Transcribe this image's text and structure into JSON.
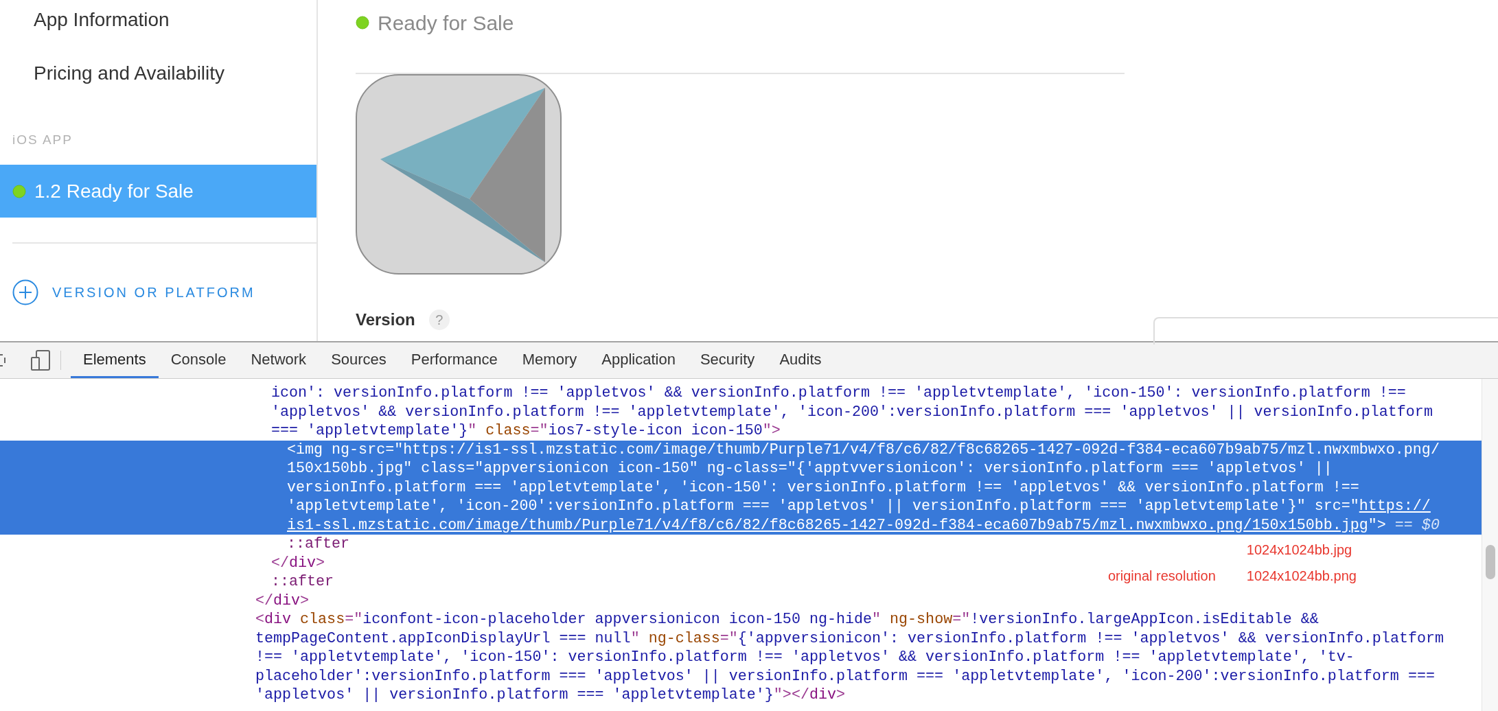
{
  "sidebar": {
    "items": [
      {
        "label": "App Information",
        "selected": false
      },
      {
        "label": "Pricing and Availability",
        "selected": false
      }
    ],
    "section_header": "iOS APP",
    "versions": [
      {
        "label": "1.2 Ready for Sale",
        "selected": true
      }
    ],
    "add_button": "VERSION OR PLATFORM"
  },
  "status": {
    "label": "Ready for Sale"
  },
  "version_field": {
    "label": "Version",
    "help": "?"
  },
  "devtools": {
    "tabs": [
      {
        "label": "Elements",
        "selected": true
      },
      {
        "label": "Console",
        "selected": false
      },
      {
        "label": "Network",
        "selected": false
      },
      {
        "label": "Sources",
        "selected": false
      },
      {
        "label": "Performance",
        "selected": false
      },
      {
        "label": "Memory",
        "selected": false
      },
      {
        "label": "Application",
        "selected": false
      },
      {
        "label": "Security",
        "selected": false
      },
      {
        "label": "Audits",
        "selected": false
      }
    ],
    "elements_tree": [
      {
        "children": [
          {
            "selected": false,
            "lines": [
              [
                {
                  "kind": "value",
                  "text": "icon': versionInfo.platform !== 'appletvos' && versionInfo.platform !== 'appletvtemplate', 'icon-150': versionInfo.platform !=="
                }
              ],
              [
                {
                  "kind": "value",
                  "text": "'appletvos' && versionInfo.platform !== 'appletvtemplate', 'icon-200':versionInfo.platform === 'appletvos' || versionInfo.platform"
                }
              ],
              [
                {
                  "kind": "value",
                  "text": "=== 'appletvtemplate'}"
                },
                {
                  "kind": "punct",
                  "text": "\""
                },
                {
                  "kind": "attr",
                  "text": " class"
                },
                {
                  "kind": "punct",
                  "text": "=\""
                },
                {
                  "kind": "value",
                  "text": "ios7-style-icon icon-150"
                },
                {
                  "kind": "punct",
                  "text": "\">"
                }
              ]
            ],
            "children": [
              {
                "selected": true,
                "lines": [
                  [
                    {
                      "kind": "punct",
                      "text": "<"
                    },
                    {
                      "kind": "tag",
                      "text": "img"
                    },
                    {
                      "kind": "attr",
                      "text": " ng-src"
                    },
                    {
                      "kind": "punct",
                      "text": "=\""
                    },
                    {
                      "kind": "value",
                      "text": "https://is1-ssl.mzstatic.com/image/thumb/Purple71/v4/f8/c6/82/f8c68265-1427-092d-f384-eca607b9ab75/mzl.nwxmbwxo.png/"
                    }
                  ],
                  [
                    {
                      "kind": "value",
                      "text": "150x150bb.jpg"
                    },
                    {
                      "kind": "punct",
                      "text": "\""
                    },
                    {
                      "kind": "attr",
                      "text": " class"
                    },
                    {
                      "kind": "punct",
                      "text": "=\""
                    },
                    {
                      "kind": "value",
                      "text": "appversionicon icon-150"
                    },
                    {
                      "kind": "punct",
                      "text": "\""
                    },
                    {
                      "kind": "attr",
                      "text": " ng-class"
                    },
                    {
                      "kind": "punct",
                      "text": "=\""
                    },
                    {
                      "kind": "value",
                      "text": "{'apptvversionicon': versionInfo.platform === 'appletvos' ||"
                    }
                  ],
                  [
                    {
                      "kind": "value",
                      "text": "versionInfo.platform === 'appletvtemplate', 'icon-150': versionInfo.platform !== 'appletvos' && versionInfo.platform !=="
                    }
                  ],
                  [
                    {
                      "kind": "value",
                      "text": "'appletvtemplate', 'icon-200':versionInfo.platform === 'appletvos' || versionInfo.platform === 'appletvtemplate'}"
                    },
                    {
                      "kind": "punct",
                      "text": "\""
                    },
                    {
                      "kind": "attr",
                      "text": " src"
                    },
                    {
                      "kind": "punct",
                      "text": "=\""
                    },
                    {
                      "kind": "link",
                      "text": "https://"
                    }
                  ],
                  [
                    {
                      "kind": "link",
                      "text": "is1-ssl.mzstatic.com/image/thumb/Purple71/v4/f8/c6/82/f8c68265-1427-092d-f384-eca607b9ab75/mzl.nwxmbwxo.png/150x150bb.jpg"
                    },
                    {
                      "kind": "punct",
                      "text": "\">"
                    },
                    {
                      "kind": "ref",
                      "text": " == $0"
                    }
                  ]
                ]
              },
              {
                "selected": false,
                "lines": [
                  [
                    {
                      "kind": "pseudo",
                      "text": "::after"
                    }
                  ]
                ]
              }
            ],
            "close": [
              {
                "kind": "punct",
                "text": "</"
              },
              {
                "kind": "tag",
                "text": "div"
              },
              {
                "kind": "punct",
                "text": ">"
              }
            ]
          },
          {
            "selected": false,
            "lines": [
              [
                {
                  "kind": "pseudo",
                  "text": "::after"
                }
              ]
            ]
          }
        ],
        "close": [
          {
            "kind": "punct",
            "text": "</"
          },
          {
            "kind": "tag",
            "text": "div"
          },
          {
            "kind": "punct",
            "text": ">"
          }
        ]
      },
      {
        "selected": false,
        "lines": [
          [
            {
              "kind": "punct",
              "text": "<"
            },
            {
              "kind": "tag",
              "text": "div"
            },
            {
              "kind": "attr",
              "text": " class"
            },
            {
              "kind": "punct",
              "text": "=\""
            },
            {
              "kind": "value",
              "text": "iconfont-icon-placeholder appversionicon icon-150 ng-hide"
            },
            {
              "kind": "punct",
              "text": "\""
            },
            {
              "kind": "attr",
              "text": " ng-show"
            },
            {
              "kind": "punct",
              "text": "=\""
            },
            {
              "kind": "value",
              "text": "!versionInfo.largeAppIcon.isEditable &&"
            }
          ],
          [
            {
              "kind": "value",
              "text": "tempPageContent.appIconDisplayUrl === null"
            },
            {
              "kind": "punct",
              "text": "\""
            },
            {
              "kind": "attr",
              "text": " ng-class"
            },
            {
              "kind": "punct",
              "text": "=\""
            },
            {
              "kind": "value",
              "text": "{'appversionicon': versionInfo.platform !== 'appletvos' && versionInfo.platform"
            }
          ],
          [
            {
              "kind": "value",
              "text": "!== 'appletvtemplate', 'icon-150': versionInfo.platform !== 'appletvos' && versionInfo.platform !== 'appletvtemplate', 'tv-"
            }
          ],
          [
            {
              "kind": "value",
              "text": "placeholder':versionInfo.platform === 'appletvos' || versionInfo.platform === 'appletvtemplate', 'icon-200':versionInfo.platform ==="
            }
          ],
          [
            {
              "kind": "value",
              "text": "'appletvos' || versionInfo.platform === 'appletvtemplate'}"
            },
            {
              "kind": "punct",
              "text": "\"></"
            },
            {
              "kind": "tag",
              "text": "div"
            },
            {
              "kind": "punct",
              "text": ">"
            }
          ]
        ]
      }
    ],
    "resolution_hint": {
      "label": "original resolution",
      "items": [
        "1024x1024bb.jpg",
        "1024x1024bb.png"
      ]
    }
  }
}
